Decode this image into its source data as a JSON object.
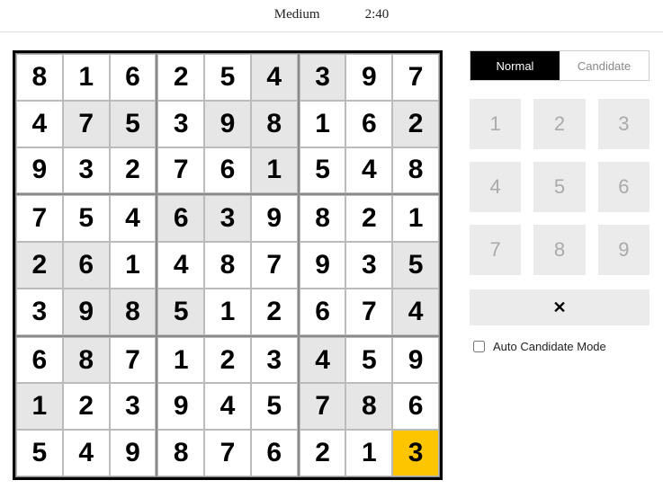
{
  "header": {
    "difficulty": "Medium",
    "timer": "2:40"
  },
  "board": {
    "values": [
      [
        8,
        1,
        6,
        2,
        5,
        4,
        3,
        9,
        7
      ],
      [
        4,
        7,
        5,
        3,
        9,
        8,
        1,
        6,
        2
      ],
      [
        9,
        3,
        2,
        7,
        6,
        1,
        5,
        4,
        8
      ],
      [
        7,
        5,
        4,
        6,
        3,
        9,
        8,
        2,
        1
      ],
      [
        2,
        6,
        1,
        4,
        8,
        7,
        9,
        3,
        5
      ],
      [
        3,
        9,
        8,
        5,
        1,
        2,
        6,
        7,
        4
      ],
      [
        6,
        8,
        7,
        1,
        2,
        3,
        4,
        5,
        9
      ],
      [
        1,
        2,
        3,
        9,
        4,
        5,
        7,
        8,
        6
      ],
      [
        5,
        4,
        9,
        8,
        7,
        6,
        2,
        1,
        3
      ]
    ],
    "given": [
      [
        0,
        0,
        0,
        0,
        0,
        1,
        1,
        0,
        0
      ],
      [
        0,
        1,
        1,
        0,
        1,
        1,
        0,
        0,
        1
      ],
      [
        0,
        0,
        0,
        0,
        0,
        1,
        0,
        0,
        0
      ],
      [
        0,
        0,
        0,
        1,
        1,
        0,
        0,
        0,
        0
      ],
      [
        1,
        1,
        0,
        0,
        0,
        0,
        0,
        0,
        1
      ],
      [
        0,
        1,
        1,
        1,
        0,
        0,
        0,
        0,
        1
      ],
      [
        0,
        1,
        0,
        0,
        0,
        0,
        1,
        0,
        0
      ],
      [
        1,
        0,
        0,
        0,
        0,
        0,
        1,
        1,
        0
      ],
      [
        0,
        0,
        0,
        0,
        0,
        0,
        0,
        0,
        0
      ]
    ],
    "active": [
      8,
      8
    ]
  },
  "panel": {
    "tabs": {
      "normal": "Normal",
      "candidate": "Candidate",
      "active": "normal"
    },
    "keys": [
      "1",
      "2",
      "3",
      "4",
      "5",
      "6",
      "7",
      "8",
      "9"
    ],
    "clear_glyph": "✕",
    "auto_label": "Auto Candidate Mode",
    "auto_checked": false
  }
}
